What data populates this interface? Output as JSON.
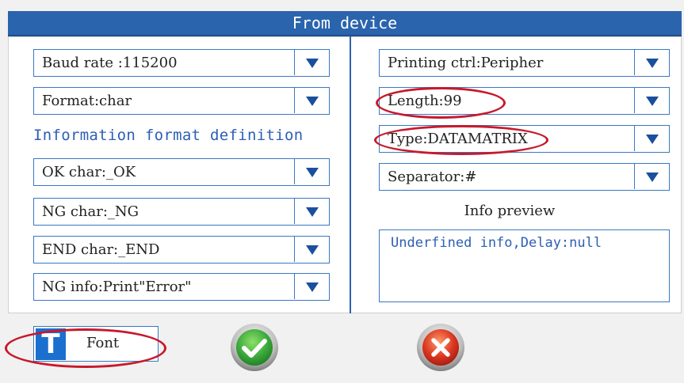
{
  "window": {
    "title": "From device"
  },
  "left": {
    "baud_rate": "Baud rate :115200",
    "format": "Format:char",
    "section_label": "Information format definition",
    "ok_char": "OK char:_OK",
    "ng_char": "NG char:_NG",
    "end_char": "END char:_END",
    "ng_info": "NG info:Print\"Error\""
  },
  "right": {
    "printing_ctrl": "Printing ctrl:Peripher",
    "length": "Length:99",
    "type": "Type:DATAMATRIX",
    "separator": "Separator:#",
    "preview_label": "Info preview",
    "preview_text": "Underfined info,Delay:null"
  },
  "bottom": {
    "font_icon_letter": "T",
    "font_label": "Font"
  },
  "colors": {
    "title_bar": "#2a64ad",
    "border": "#3b78c0",
    "arrow": "#1a4f9e",
    "accent_text": "#2c5fb3",
    "highlight_ellipse": "#c7192c",
    "confirm": "#3aa83a",
    "cancel": "#d9351f"
  },
  "icons": [
    "chevron-down-icon",
    "font-icon",
    "confirm-check-icon",
    "cancel-x-icon"
  ]
}
